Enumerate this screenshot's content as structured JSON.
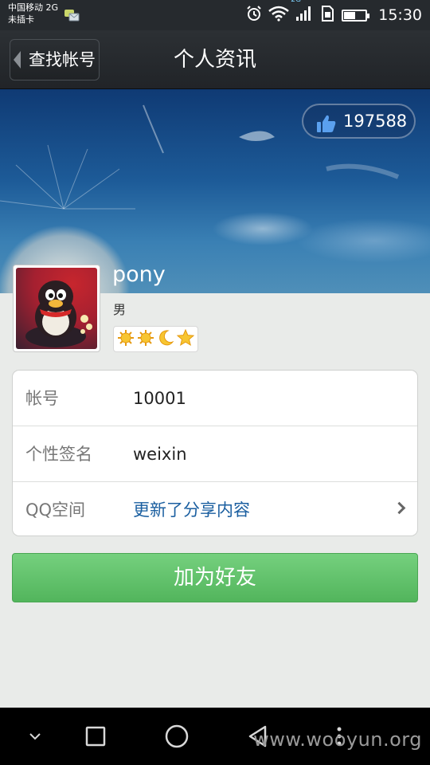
{
  "status_bar": {
    "carrier_line1": "中国移动 2G",
    "carrier_line2": "未插卡",
    "network_badge": "2G",
    "time": "15:30",
    "battery_level": 0.5,
    "icons": [
      "sms-notification-icon",
      "alarm-icon",
      "wifi-icon",
      "signal-icon",
      "sim-icon",
      "battery-icon"
    ]
  },
  "header": {
    "back_label": "查找帐号",
    "title": "个人资讯"
  },
  "cover": {
    "like_count": "197588",
    "like_icon": "thumbs-up-icon"
  },
  "profile": {
    "nickname": "pony",
    "gender": "男",
    "level_icons": [
      "sun-icon",
      "sun-icon",
      "moon-icon",
      "star-icon"
    ]
  },
  "info": {
    "rows": [
      {
        "label": "帐号",
        "value": "10001"
      },
      {
        "label": "个性签名",
        "value": "weixin"
      },
      {
        "label": "QQ空间",
        "value": "更新了分享内容"
      }
    ]
  },
  "actions": {
    "add_friend_label": "加为好友"
  },
  "nav_bar": {
    "icons": [
      "collapse-icon",
      "recent-apps-icon",
      "home-icon",
      "back-icon",
      "menu-icon"
    ],
    "watermark": "www.wooyun.org"
  },
  "colors": {
    "title_bar": "#262a2e",
    "background": "#e9ebe9",
    "accent_green": "#5ec167",
    "link_blue": "#1b5fa0"
  }
}
